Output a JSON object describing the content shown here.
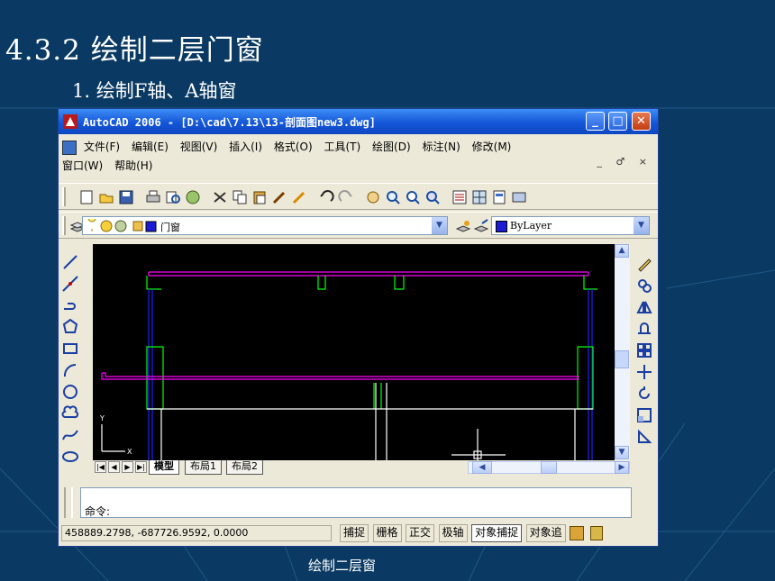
{
  "slide": {
    "title": "4.3.2 绘制二层门窗",
    "subtitle": "1. 绘制F轴、A轴窗",
    "caption": "绘制二层窗"
  },
  "window": {
    "title": "AutoCAD 2006 - [D:\\cad\\7.13\\13-剖面图new3.dwg]",
    "buttons": {
      "minimize": "_",
      "maximize": "□",
      "close": "✕"
    }
  },
  "menu": {
    "row1": [
      "文件(F)",
      "编辑(E)",
      "视图(V)",
      "插入(I)",
      "格式(O)",
      "工具(T)",
      "绘图(D)",
      "标注(N)",
      "修改(M)"
    ],
    "row2": [
      "窗口(W)",
      "帮助(H)"
    ],
    "mdi_controls": "_ ♂ ×"
  },
  "layers": {
    "current_layer": "门窗",
    "color_combo": "ByLayer"
  },
  "layout_tabs": [
    "模型",
    "布局1",
    "布局2"
  ],
  "active_tab": "模型",
  "command": {
    "prompt": "命令:"
  },
  "status": {
    "coordinates": "458889.2798, -687726.9592, 0.0000",
    "toggles": [
      "捕捉",
      "栅格",
      "正交",
      "极轴",
      "对象捕捉",
      "对象追"
    ],
    "active_toggles": [
      "对象捕捉"
    ]
  },
  "ucs": {
    "x_label": "X",
    "y_label": "Y"
  },
  "colors": {
    "slide_bg": "#0a3a63",
    "title_bar": "#1456d8",
    "cad_magenta": "#ff00ff",
    "cad_green": "#00ff00",
    "cad_blue": "#2020ff",
    "cad_white": "#ffffff"
  }
}
